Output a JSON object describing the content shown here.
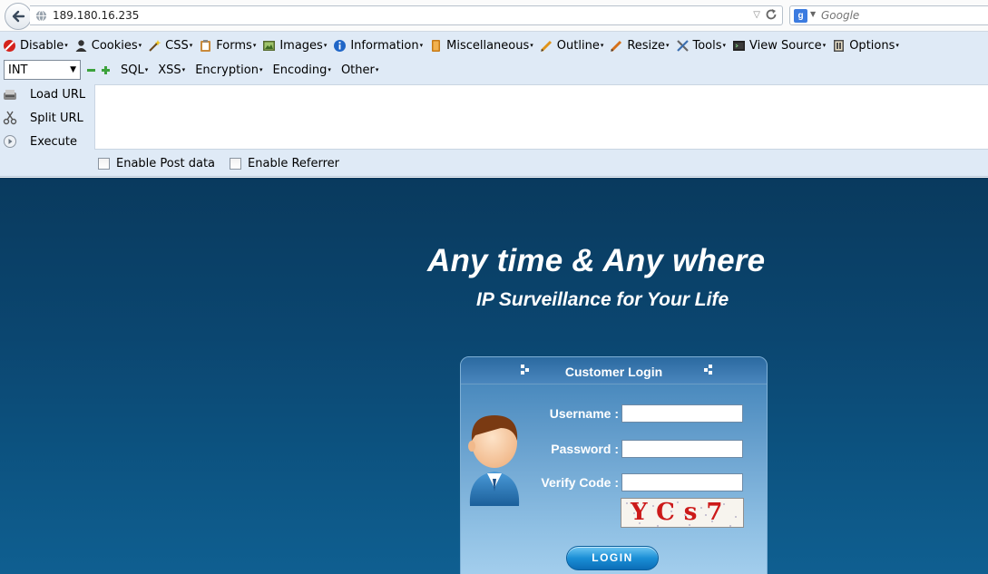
{
  "navbar": {
    "url": "189.180.16.235",
    "search_placeholder": "Google"
  },
  "webdev_toolbar": {
    "items": [
      {
        "label": "Disable",
        "icon": "disable-icon"
      },
      {
        "label": "Cookies",
        "icon": "cookies-icon"
      },
      {
        "label": "CSS",
        "icon": "css-icon"
      },
      {
        "label": "Forms",
        "icon": "forms-icon"
      },
      {
        "label": "Images",
        "icon": "images-icon"
      },
      {
        "label": "Information",
        "icon": "information-icon"
      },
      {
        "label": "Miscellaneous",
        "icon": "miscellaneous-icon"
      },
      {
        "label": "Outline",
        "icon": "outline-icon"
      },
      {
        "label": "Resize",
        "icon": "resize-icon"
      },
      {
        "label": "Tools",
        "icon": "tools-icon"
      },
      {
        "label": "View Source",
        "icon": "view-source-icon"
      },
      {
        "label": "Options",
        "icon": "options-icon"
      }
    ]
  },
  "hackbar": {
    "select_value": "INT",
    "menus": [
      "SQL",
      "XSS",
      "Encryption",
      "Encoding",
      "Other"
    ],
    "side": [
      {
        "label": "Load URL",
        "icon": "load-url-icon"
      },
      {
        "label": "Split URL",
        "icon": "split-url-icon"
      },
      {
        "label": "Execute",
        "icon": "execute-icon"
      }
    ],
    "checkboxes": [
      "Enable Post data",
      "Enable Referrer"
    ]
  },
  "page": {
    "headline": "Any time & Any where",
    "subline": "IP Surveillance for Your Life",
    "login": {
      "title": "Customer Login",
      "username_label": "Username :",
      "password_label": "Password :",
      "verify_label": "Verify Code :",
      "captcha": "YCs7",
      "button": "LOGIN"
    }
  },
  "colors": {
    "page_bg": "#0b4670",
    "toolbar_bg": "#dfeaf6",
    "panel_top": "#3c7fb6",
    "panel_bottom": "#a6d0ee",
    "button": "#1b8fd6"
  }
}
